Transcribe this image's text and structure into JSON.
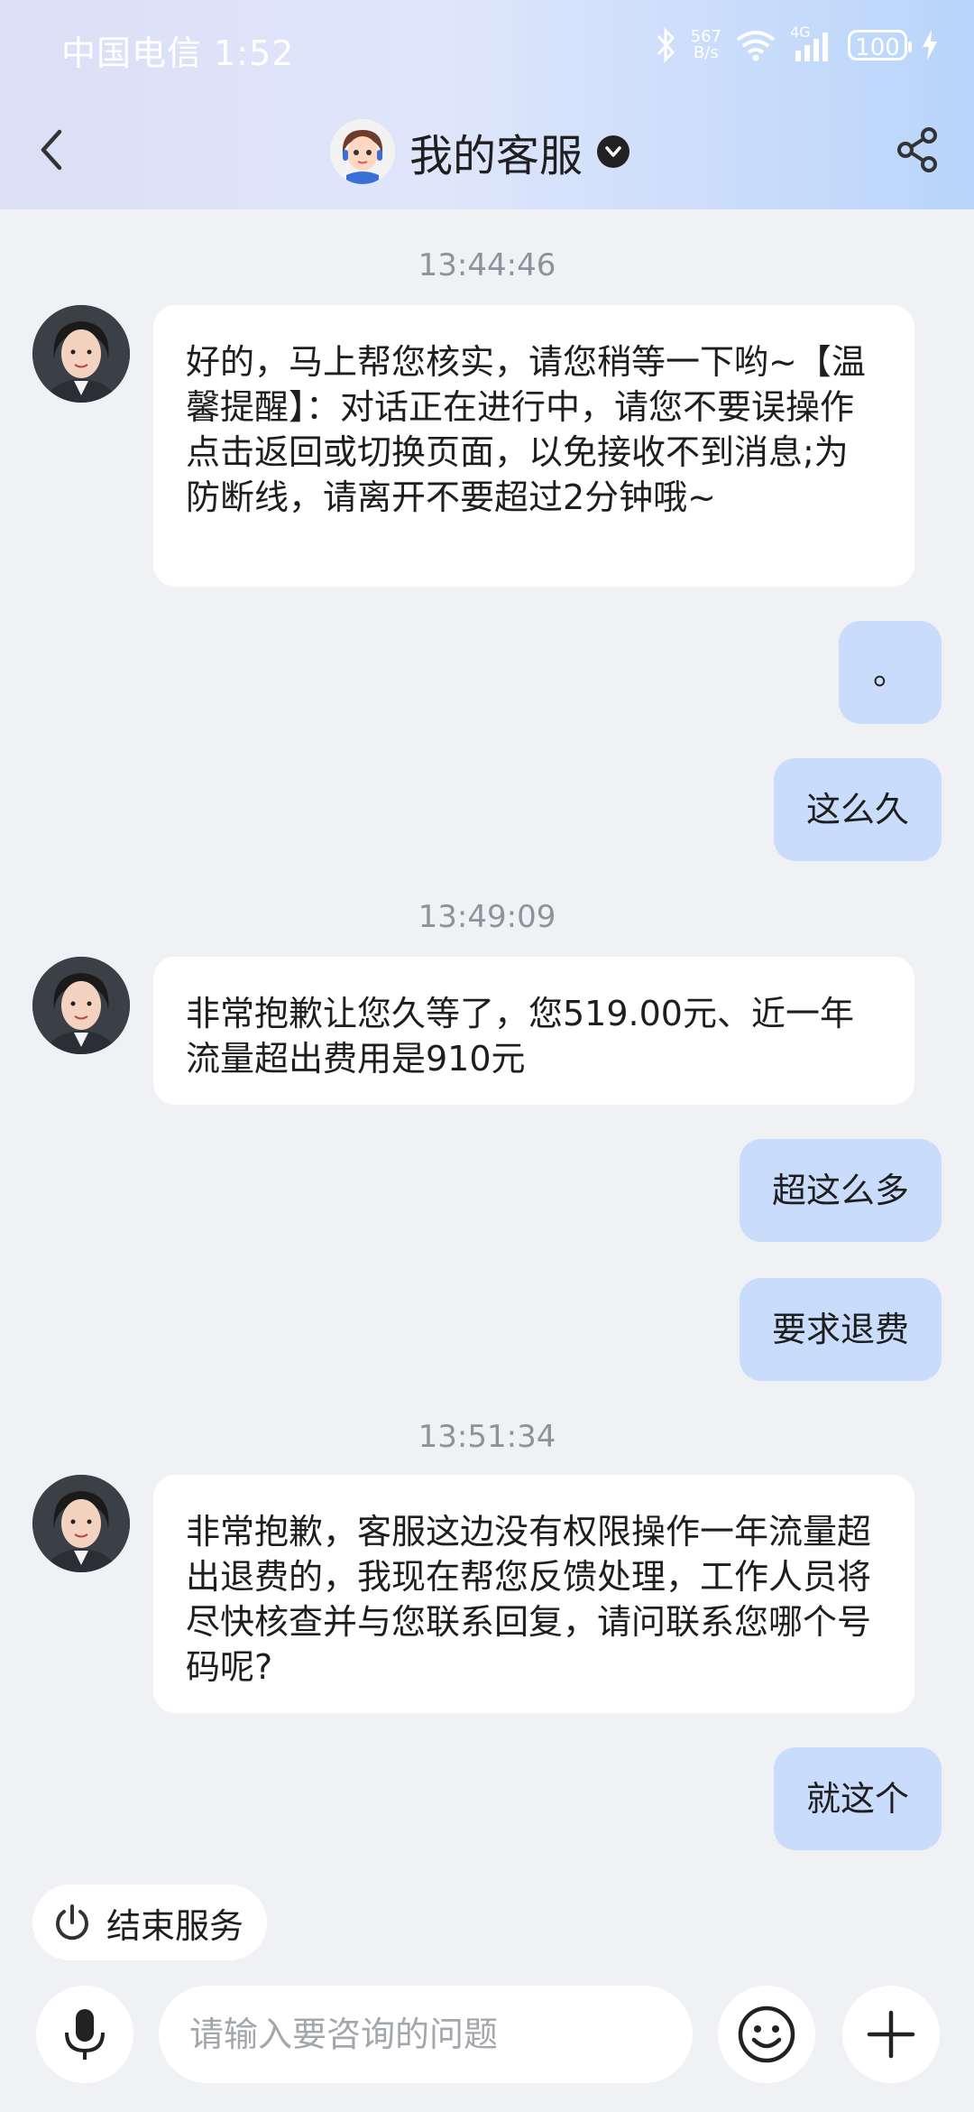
{
  "status_bar": {
    "carrier_time": "中国电信 1:52",
    "net_speed_top": "567",
    "net_speed_unit": "B/s",
    "network_type": "4G",
    "battery": "100"
  },
  "header": {
    "title": "我的客服",
    "icons": {
      "back": "back-arrow-icon",
      "dropdown": "chevron-down-circle-icon",
      "share": "share-icon"
    }
  },
  "chat": {
    "timestamps": [
      "13:44:46",
      "13:49:09",
      "13:51:34"
    ],
    "agent_messages": [
      "好的，马上帮您核实，请您稍等一下哟~【温馨提醒】：对话正在进行中，请您不要误操作点击返回或切换页面，以免接收不到消息;为防断线，请离开不要超过2分钟哦~",
      "非常抱歉让您久等了，您519.00元、近一年流量超出费用是910元",
      "非常抱歉，客服这边没有权限操作一年流量超出退费的，我现在帮您反馈处理，工作人员将尽快核查并与您联系回复，请问联系您哪个号码呢?"
    ],
    "user_messages": [
      "。",
      "这么久",
      "超这么多",
      "要求退费",
      "就这个"
    ]
  },
  "actions": {
    "end_service_label": "结束服务"
  },
  "input": {
    "placeholder": "请输入要咨询的问题"
  },
  "colors": {
    "user_bubble": "#c9dcfb",
    "agent_bubble": "#ffffff",
    "background": "#f0f1f4"
  }
}
